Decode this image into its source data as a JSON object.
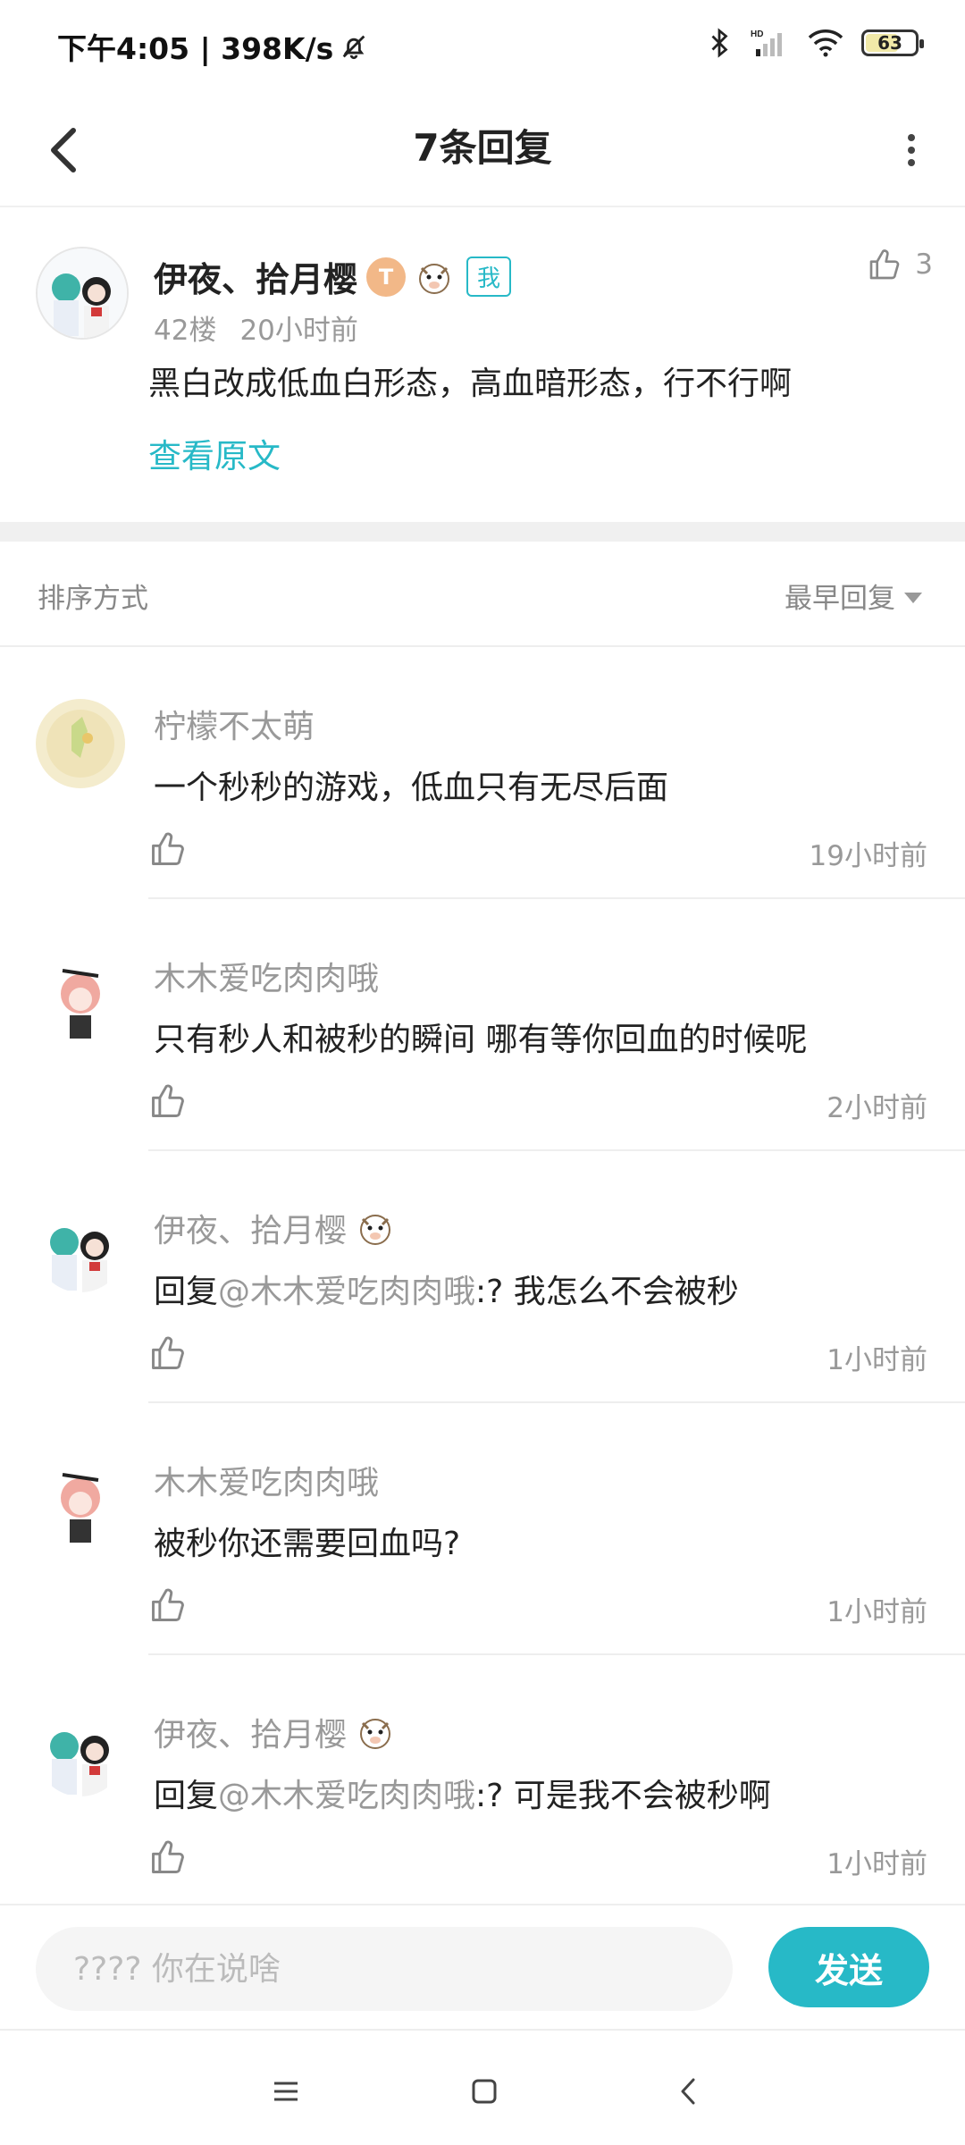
{
  "status_bar": {
    "time_speed": "下午4:05 | 398K/s",
    "battery": "63"
  },
  "header": {
    "title": "7条回复"
  },
  "main_post": {
    "username": "伊夜、拾月樱",
    "level_badge": "T",
    "me_tag": "我",
    "floor": "42楼",
    "time": "20小时前",
    "content": "黑白改成低血白形态，高血暗形态，行不行啊",
    "view_original": "查看原文",
    "like_count": "3"
  },
  "sort": {
    "label": "排序方式",
    "selected": "最早回复"
  },
  "replies": [
    {
      "username": "柠檬不太萌",
      "text": "一个秒秒的游戏，低血只有无尽后面",
      "mention": "",
      "time": "19小时前"
    },
    {
      "username": "木木爱吃肉肉哦",
      "text": "只有秒人和被秒的瞬间 哪有等你回血的时候呢",
      "mention": "",
      "time": "2小时前"
    },
    {
      "username": "伊夜、拾月樱",
      "prefix": "回复",
      "mention": "@木木爱吃肉肉哦",
      "text": ":? 我怎么不会被秒",
      "time": "1小时前"
    },
    {
      "username": "木木爱吃肉肉哦",
      "text": "被秒你还需要回血吗?",
      "mention": "",
      "time": "1小时前"
    },
    {
      "username": "伊夜、拾月樱",
      "prefix": "回复",
      "mention": "@木木爱吃肉肉哦",
      "text": ":? 可是我不会被秒啊",
      "time": "1小时前"
    }
  ],
  "input": {
    "placeholder": "???? 你在说啥",
    "send_label": "发送"
  },
  "colors": {
    "accent": "#27b9c7",
    "muted_text": "#999999",
    "primary_text": "#222222"
  }
}
